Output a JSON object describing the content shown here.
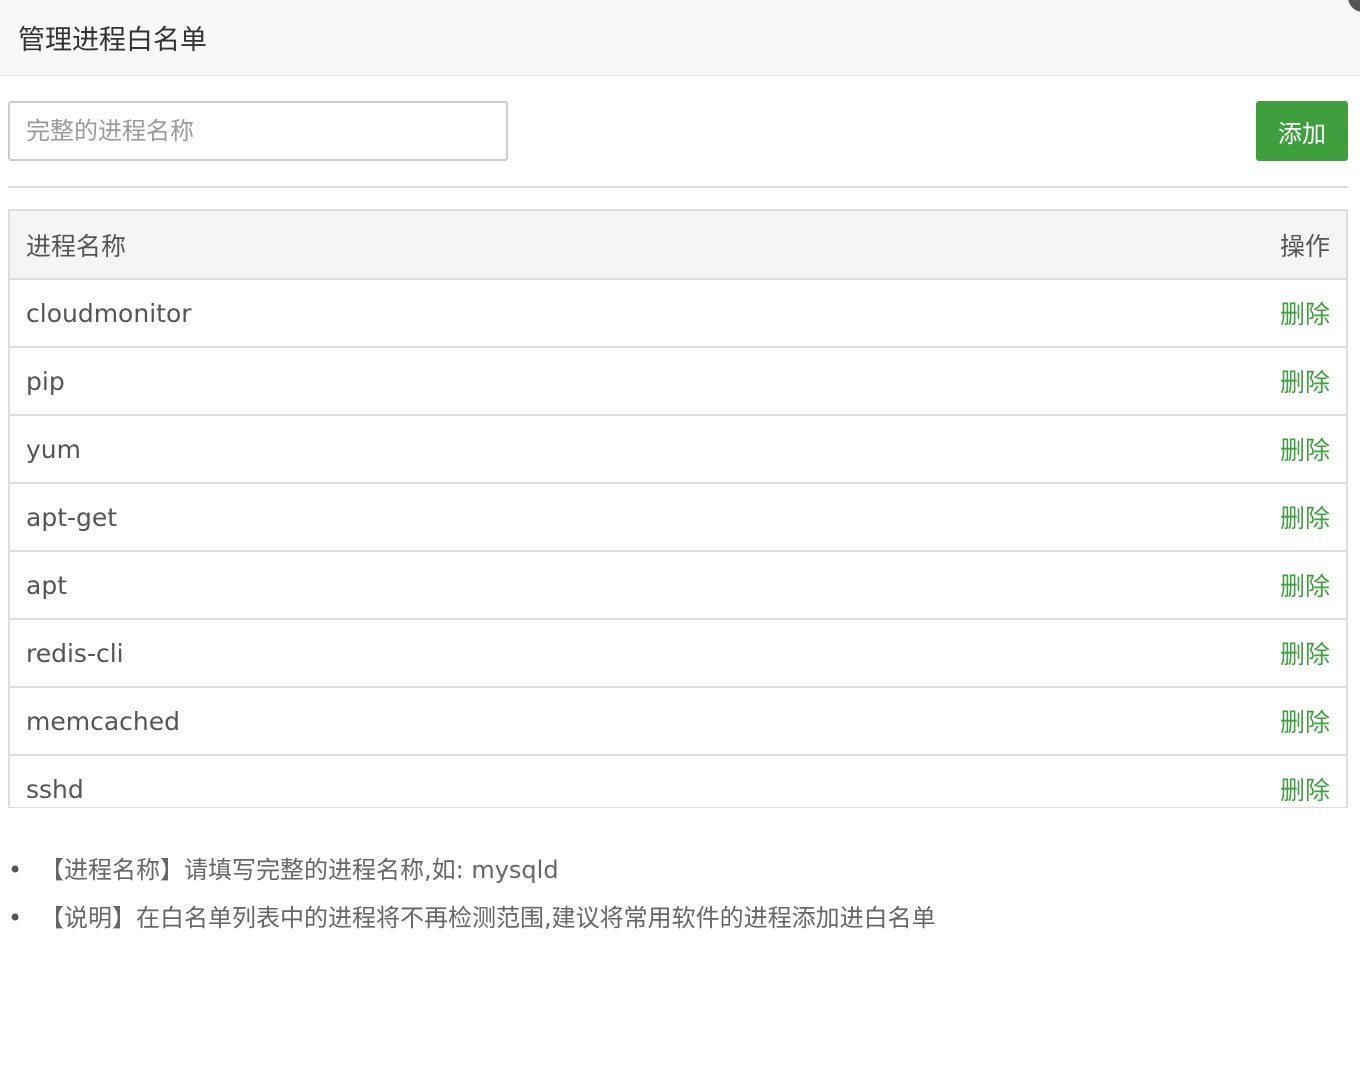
{
  "dialog": {
    "title": "管理进程白名单"
  },
  "form": {
    "input_placeholder": "完整的进程名称",
    "input_value": "",
    "add_label": "添加"
  },
  "table": {
    "headers": {
      "name": "进程名称",
      "action": "操作"
    },
    "rows": [
      {
        "name": "cloudmonitor",
        "action": "删除"
      },
      {
        "name": "pip",
        "action": "删除"
      },
      {
        "name": "yum",
        "action": "删除"
      },
      {
        "name": "apt-get",
        "action": "删除"
      },
      {
        "name": "apt",
        "action": "删除"
      },
      {
        "name": "redis-cli",
        "action": "删除"
      },
      {
        "name": "memcached",
        "action": "删除"
      },
      {
        "name": "sshd",
        "action": "删除"
      }
    ]
  },
  "notes": [
    "【进程名称】请填写完整的进程名称,如: mysqld",
    "【说明】在白名单列表中的进程将不再检测范围,建议将常用软件的进程添加进白名单"
  ],
  "colors": {
    "accent": "#3f9f3f",
    "title_bar_bg": "#f8f8f8",
    "table_header_bg": "#f5f5f5",
    "border": "#dddddd"
  }
}
